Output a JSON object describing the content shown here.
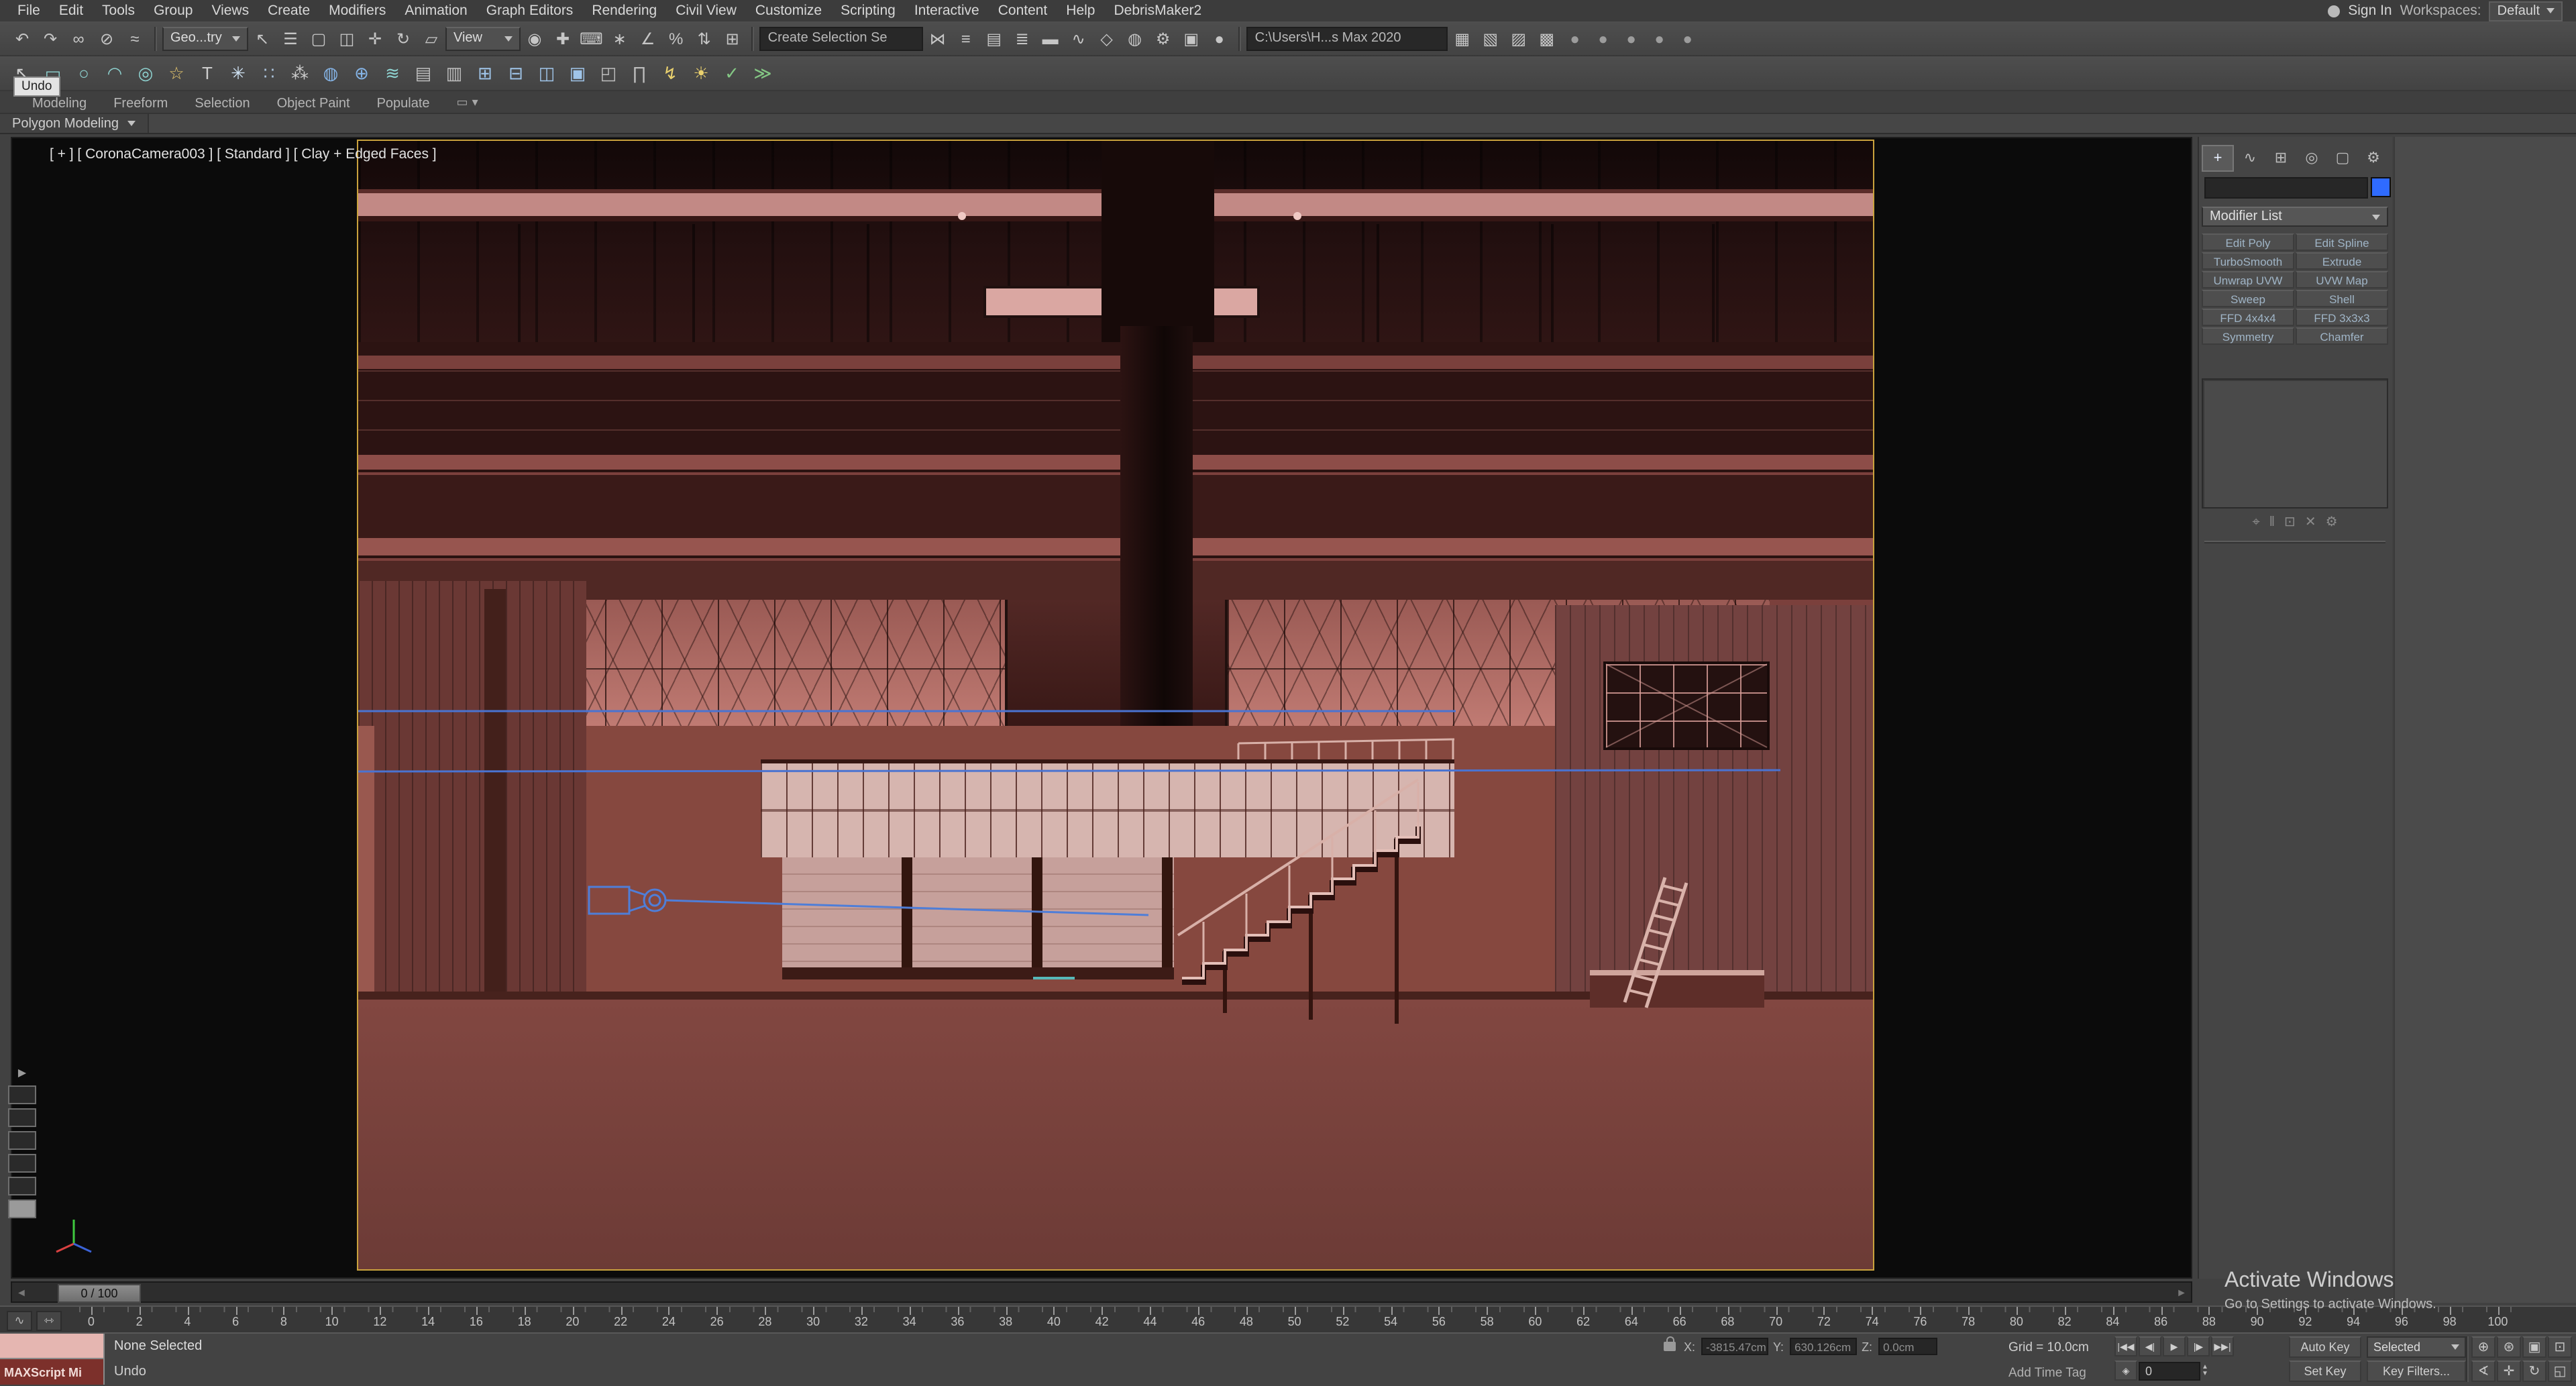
{
  "colors": {
    "accent_frame": "#c9a23d",
    "viewport_bg": "#0b0b0b",
    "panel_bg": "#454545",
    "scene_wall": "#7b403c",
    "scene_floor": "#824741",
    "spline_blue": "#4a73d1",
    "object_color_swatch": "#2f6bff",
    "macro_pink": "#e5b6b1",
    "listener_maroon": "#7c302b"
  },
  "menu": {
    "items": [
      "File",
      "Edit",
      "Tools",
      "Group",
      "Views",
      "Create",
      "Modifiers",
      "Animation",
      "Graph Editors",
      "Rendering",
      "Civil View",
      "Customize",
      "Scripting",
      "Interactive",
      "Content",
      "Help",
      "DebrisMaker2"
    ],
    "sign_in": "Sign In",
    "workspaces_label": "Workspaces:",
    "workspace_value": "Default"
  },
  "tooltip": "Undo",
  "toolbar1": {
    "icons_a": [
      {
        "name": "undo-icon",
        "glyph": "↶",
        "color": "#c6c6c6"
      },
      {
        "name": "redo-icon",
        "glyph": "↷",
        "color": "#c6c6c6"
      },
      {
        "name": "select-and-link-icon",
        "glyph": "∞",
        "color": "#c6c6c6"
      },
      {
        "name": "unlink-selection-icon",
        "glyph": "⊘",
        "color": "#c6c6c6"
      },
      {
        "name": "bind-to-space-warp-icon",
        "glyph": "≈",
        "color": "#c6c6c6"
      }
    ],
    "filter_value": "Geo...try",
    "icons_b": [
      {
        "name": "select-object-icon",
        "glyph": "↖",
        "color": "#c6c6c6"
      },
      {
        "name": "select-by-name-icon",
        "glyph": "☰",
        "color": "#c6c6c6"
      },
      {
        "name": "selection-region-icon",
        "glyph": "▢",
        "color": "#c6c6c6"
      },
      {
        "name": "window-crossing-icon",
        "glyph": "◫",
        "color": "#c6c6c6"
      },
      {
        "name": "select-and-move-icon",
        "glyph": "✛",
        "color": "#c6c6c6"
      },
      {
        "name": "select-and-rotate-icon",
        "glyph": "↻",
        "color": "#c6c6c6"
      },
      {
        "name": "select-and-scale-icon",
        "glyph": "▱",
        "color": "#c6c6c6"
      }
    ],
    "coord_value": "View",
    "icons_c": [
      {
        "name": "use-pivot-center-icon",
        "glyph": "◉",
        "color": "#c6c6c6"
      },
      {
        "name": "select-and-manipulate-icon",
        "glyph": "✚",
        "color": "#c6c6c6"
      },
      {
        "name": "keyboard-override-icon",
        "glyph": "⌨",
        "color": "#c6c6c6"
      },
      {
        "name": "snaps-toggle-icon",
        "glyph": "∗",
        "color": "#c6c6c6"
      },
      {
        "name": "angle-snap-icon",
        "glyph": "∠",
        "color": "#c6c6c6"
      },
      {
        "name": "percent-snap-icon",
        "glyph": "%",
        "color": "#c6c6c6"
      },
      {
        "name": "spinner-snap-icon",
        "glyph": "⇅",
        "color": "#c6c6c6"
      },
      {
        "name": "named-selection-sets-icon",
        "glyph": "⊞",
        "color": "#c6c6c6"
      }
    ],
    "selection_set_value": "Create Selection Se",
    "icons_d": [
      {
        "name": "mirror-icon",
        "glyph": "⋈",
        "color": "#c6c6c6"
      },
      {
        "name": "align-icon",
        "glyph": "≡",
        "color": "#c6c6c6"
      },
      {
        "name": "scene-explorer-icon",
        "glyph": "▤",
        "color": "#c6c6c6"
      },
      {
        "name": "layer-explorer-icon",
        "glyph": "≣",
        "color": "#c6c6c6"
      },
      {
        "name": "ribbon-toggle-icon",
        "glyph": "▬",
        "color": "#c6c6c6"
      },
      {
        "name": "curve-editor-icon",
        "glyph": "∿",
        "color": "#c6c6c6"
      },
      {
        "name": "schematic-view-icon",
        "glyph": "◇",
        "color": "#c6c6c6"
      },
      {
        "name": "material-editor-icon",
        "glyph": "◍",
        "color": "#c6c6c6"
      },
      {
        "name": "render-setup-icon",
        "glyph": "⚙",
        "color": "#c6c6c6"
      },
      {
        "name": "rendered-frame-window-icon",
        "glyph": "▣",
        "color": "#c6c6c6"
      },
      {
        "name": "render-production-icon",
        "glyph": "●",
        "color": "#c6c6c6"
      }
    ],
    "path_value": "C:\\Users\\H...s Max 2020",
    "icons_e": [
      {
        "name": "project-folder-icon",
        "glyph": "▦",
        "color": "#c6c6c6"
      },
      {
        "name": "asset-tracking-icon",
        "glyph": "▧",
        "color": "#c6c6c6"
      },
      {
        "name": "scene-converter-icon",
        "glyph": "▨",
        "color": "#c6c6c6"
      },
      {
        "name": "state-sets-icon",
        "glyph": "▩",
        "color": "#c6c6c6"
      },
      {
        "name": "render-flyout-1-icon",
        "glyph": "●",
        "color": "#9c9c9c"
      },
      {
        "name": "render-flyout-2-icon",
        "glyph": "●",
        "color": "#9c9c9c"
      },
      {
        "name": "render-flyout-3-icon",
        "glyph": "●",
        "color": "#9c9c9c"
      },
      {
        "name": "render-flyout-4-icon",
        "glyph": "●",
        "color": "#9c9c9c"
      },
      {
        "name": "render-flyout-5-icon",
        "glyph": "●",
        "color": "#9c9c9c"
      }
    ]
  },
  "toolbar2": {
    "icons": [
      {
        "name": "select-pointer-icon",
        "glyph": "↖",
        "color": "#cdcdcd"
      },
      {
        "name": "rectangle-shape-icon",
        "glyph": "▭",
        "color": "#8ed2d0"
      },
      {
        "name": "circle-shape-icon",
        "glyph": "○",
        "color": "#8ed2d0"
      },
      {
        "name": "arc-shape-icon",
        "glyph": "◠",
        "color": "#8ed2d0"
      },
      {
        "name": "donut-shape-icon",
        "glyph": "◎",
        "color": "#8ed2d0"
      },
      {
        "name": "star-shape-icon",
        "glyph": "☆",
        "color": "#e9c96e"
      },
      {
        "name": "text-shape-icon",
        "glyph": "T",
        "color": "#cdcdcd"
      },
      {
        "name": "snowflake-icon",
        "glyph": "✳",
        "color": "#cfe2f3"
      },
      {
        "name": "scatter-icon",
        "glyph": "∷",
        "color": "#a9c0d8"
      },
      {
        "name": "spray-icon",
        "glyph": "⁂",
        "color": "#cdcdcd"
      },
      {
        "name": "sphere-icon",
        "glyph": "◍",
        "color": "#85b4e6"
      },
      {
        "name": "geosphere-icon",
        "glyph": "⊕",
        "color": "#85b4e6"
      },
      {
        "name": "waves-icon",
        "glyph": "≋",
        "color": "#8ed2d0"
      },
      {
        "name": "panel-a-icon",
        "glyph": "▤",
        "color": "#bdbdbd"
      },
      {
        "name": "panel-b-icon",
        "glyph": "▥",
        "color": "#bdbdbd"
      },
      {
        "name": "array-icon",
        "glyph": "⊞",
        "color": "#9fc4e8"
      },
      {
        "name": "array-minus-icon",
        "glyph": "⊟",
        "color": "#9fc4e8"
      },
      {
        "name": "mirror-tool-icon",
        "glyph": "◫",
        "color": "#9fc4e8"
      },
      {
        "name": "grid-array-icon",
        "glyph": "▣",
        "color": "#9fc4e8"
      },
      {
        "name": "layout-icon",
        "glyph": "◰",
        "color": "#bdbdbd"
      },
      {
        "name": "measure-icon",
        "glyph": "∏",
        "color": "#bdbdbd"
      },
      {
        "name": "lightning-icon",
        "glyph": "↯",
        "color": "#e9d06e"
      },
      {
        "name": "sun-icon",
        "glyph": "☀",
        "color": "#e9d06e"
      },
      {
        "name": "check-icon",
        "glyph": "✓",
        "color": "#84c784"
      },
      {
        "name": "double-chevron-icon",
        "glyph": "≫",
        "color": "#84c784"
      }
    ]
  },
  "ribbon": {
    "tabs": [
      "Modeling",
      "Freeform",
      "Selection",
      "Object Paint",
      "Populate"
    ],
    "controls": [
      {
        "name": "ribbon-frame-icon",
        "glyph": "▭"
      },
      {
        "name": "ribbon-minimize-icon",
        "glyph": "▾"
      }
    ],
    "panel_tab": "Polygon Modeling"
  },
  "viewport": {
    "label": "[ + ] [ CoronaCamera003 ] [ Standard ] [ Clay + Edged Faces ]"
  },
  "command_panel": {
    "tabs": [
      {
        "name": "create-tab-icon",
        "glyph": "+"
      },
      {
        "name": "modify-tab-icon",
        "glyph": "∿"
      },
      {
        "name": "hierarchy-tab-icon",
        "glyph": "⊞"
      },
      {
        "name": "motion-tab-icon",
        "glyph": "◎"
      },
      {
        "name": "display-tab-icon",
        "glyph": "▢"
      },
      {
        "name": "utilities-tab-icon",
        "glyph": "⚙"
      }
    ],
    "modifier_list_label": "Modifier List",
    "modifier_buttons": [
      "Edit Poly",
      "Edit Spline",
      "TurboSmooth",
      "Extrude",
      "Unwrap UVW",
      "UVW Map",
      "Sweep",
      "Shell",
      "FFD 4x4x4",
      "FFD 3x3x3",
      "Symmetry",
      "Chamfer"
    ],
    "stack_tools": [
      {
        "name": "pin-stack-icon",
        "glyph": "⌖"
      },
      {
        "name": "show-end-result-icon",
        "glyph": "‖"
      },
      {
        "name": "make-unique-icon",
        "glyph": "⊡"
      },
      {
        "name": "remove-modifier-icon",
        "glyph": "✕"
      },
      {
        "name": "configure-modifier-sets-icon",
        "glyph": "⚙"
      }
    ]
  },
  "timeline": {
    "slider_label": "0 / 100",
    "ticks": [
      0,
      2,
      4,
      6,
      8,
      10,
      12,
      14,
      16,
      18,
      20,
      22,
      24,
      26,
      28,
      30,
      32,
      34,
      36,
      38,
      40,
      42,
      44,
      46,
      48,
      50,
      52,
      54,
      56,
      58,
      60,
      62,
      64,
      66,
      68,
      70,
      72,
      74,
      76,
      78,
      80,
      82,
      84,
      86,
      88,
      90,
      92,
      94,
      96,
      98,
      100
    ]
  },
  "ruler_tools": [
    {
      "name": "mini-curve-editor-icon",
      "glyph": "∿"
    },
    {
      "name": "track-range-icon",
      "glyph": "⇿"
    }
  ],
  "status": {
    "macro_line": "",
    "listener_text": "MAXScript Mi",
    "prompt1": "None Selected",
    "prompt2": "Undo",
    "x_label": "X:",
    "x_value": "-3815.47cm",
    "y_label": "Y:",
    "y_value": "630.126cm",
    "z_label": "Z:",
    "z_value": "0.0cm",
    "grid_label": "Grid = 10.0cm",
    "add_time_tag": "Add Time Tag",
    "playback": [
      {
        "name": "go-to-start-icon",
        "glyph": "|◀◀"
      },
      {
        "name": "previous-frame-icon",
        "glyph": "◀|"
      },
      {
        "name": "play-icon",
        "glyph": "▶"
      },
      {
        "name": "next-frame-icon",
        "glyph": "|▶"
      },
      {
        "name": "go-to-end-icon",
        "glyph": "▶▶|"
      }
    ],
    "key_mode_glyph": "◈",
    "frame_value": "0",
    "spinner_up": "▲",
    "spinner_down": "▼",
    "auto_key": "Auto Key",
    "set_key": "Set Key",
    "selected_dropdown": "Selected",
    "key_filters": "Key Filters...",
    "nav_row1": [
      {
        "name": "zoom-icon",
        "glyph": "⊕"
      },
      {
        "name": "zoom-all-icon",
        "glyph": "⊛"
      },
      {
        "name": "zoom-extents-icon",
        "glyph": "▣"
      },
      {
        "name": "zoom-region-icon",
        "glyph": "⊡"
      }
    ],
    "nav_row2": [
      {
        "name": "field-of-view-icon",
        "glyph": "∢"
      },
      {
        "name": "pan-icon",
        "glyph": "✛"
      },
      {
        "name": "orbit-icon",
        "glyph": "↻"
      },
      {
        "name": "maximize-viewport-icon",
        "glyph": "◱"
      }
    ]
  },
  "watermark": {
    "line1": "Activate Windows",
    "line2": "Go to Settings to activate Windows."
  }
}
